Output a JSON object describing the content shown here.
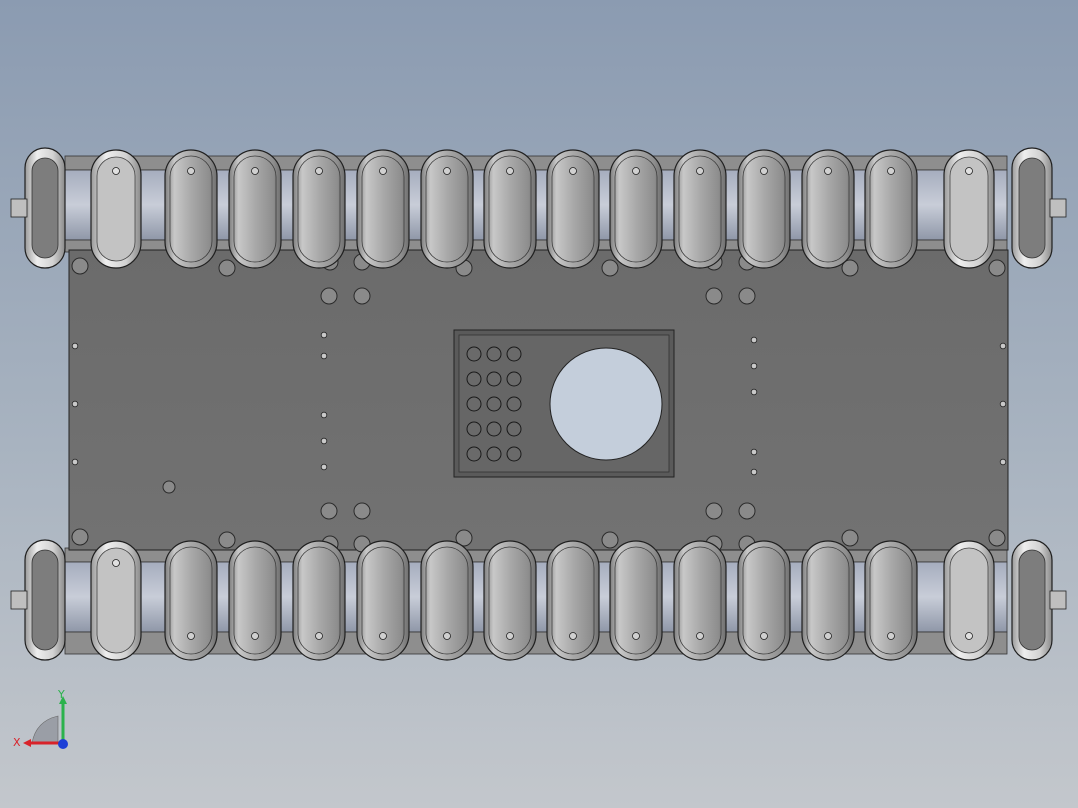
{
  "viewport": {
    "background_top": "#8b9bb1",
    "background_bottom": "#c3c7cc"
  },
  "model": {
    "plate_color": "#6e6e6e",
    "track_pad_color": "#a6a6a6",
    "track_pad_highlight": "#d9d9d9",
    "bolt_color": "#8a8a8a",
    "rail_color": "#b5b9c6",
    "rail_shadow": "#7d8596",
    "cutout_color": "#c4cedb",
    "track_pads_per_row": 12,
    "track_rows": 2,
    "drive_wheels": 4,
    "grid_holes_rows": 5,
    "grid_holes_cols": 3
  },
  "triad": {
    "x_label": "X",
    "y_label": "Y",
    "x_color": "#d8232a",
    "y_color": "#2bb24c",
    "z_color": "#1c3fd6"
  }
}
